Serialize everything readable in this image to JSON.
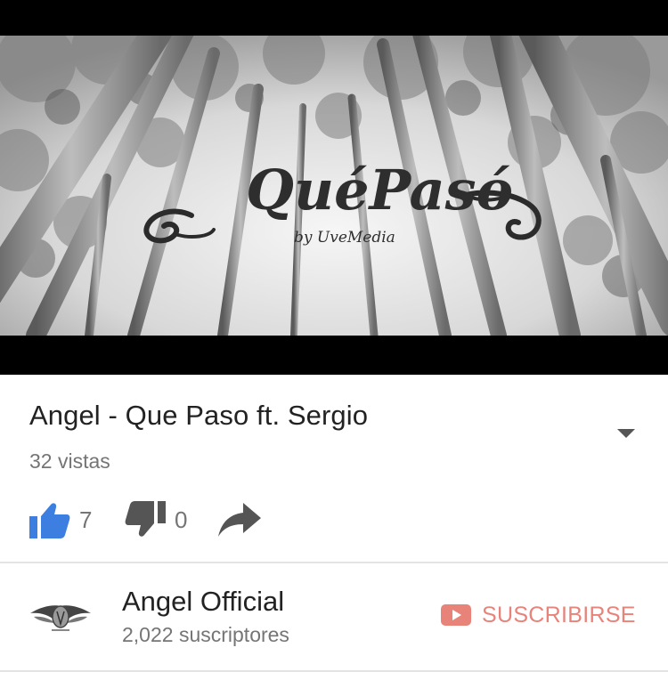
{
  "video": {
    "thumbnail_logo": "QuéPasó",
    "thumbnail_byline": "by UveMedia",
    "title": "Angel - Que Paso ft. Sergio",
    "views": "32 vistas",
    "likes": "7",
    "dislikes": "0"
  },
  "channel": {
    "name": "Angel Official",
    "subscribers": "2,022 suscriptores",
    "subscribe_label": "SUSCRIBIRSE"
  },
  "colors": {
    "like_active": "#3d7fe0",
    "icon_gray": "#555555",
    "subscribe": "#e8837a"
  },
  "icons": [
    "thumbs-up-icon",
    "thumbs-down-icon",
    "share-icon",
    "chevron-down-icon",
    "youtube-play-icon"
  ]
}
